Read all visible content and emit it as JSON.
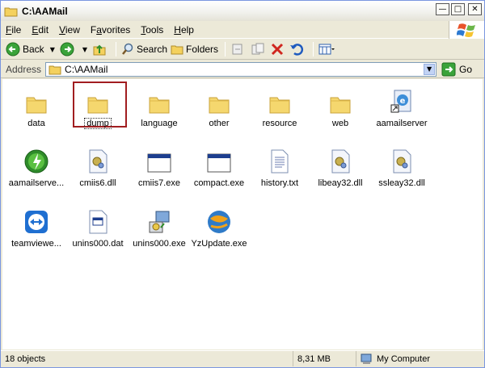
{
  "window": {
    "title": "C:\\AAMail"
  },
  "menu": [
    "File",
    "Edit",
    "View",
    "Favorites",
    "Tools",
    "Help"
  ],
  "menu_underline": [
    "F",
    "E",
    "V",
    "a",
    "T",
    "H"
  ],
  "toolbar": {
    "back_label": "Back",
    "search_label": "Search",
    "folders_label": "Folders"
  },
  "address": {
    "label": "Address",
    "value": "C:\\AAMail",
    "go_label": "Go"
  },
  "files": [
    {
      "name": "data",
      "icon": "folder-icon"
    },
    {
      "name": "dump",
      "icon": "folder-icon"
    },
    {
      "name": "language",
      "icon": "folder-icon"
    },
    {
      "name": "other",
      "icon": "folder-icon"
    },
    {
      "name": "resource",
      "icon": "folder-icon"
    },
    {
      "name": "web",
      "icon": "folder-icon"
    },
    {
      "name": "aamailserver",
      "icon": "shortcut-icon"
    },
    {
      "name": "aamailserve...",
      "icon": "app-green-icon"
    },
    {
      "name": "cmiis6.dll",
      "icon": "dll-icon"
    },
    {
      "name": "cmiis7.exe",
      "icon": "exe-icon"
    },
    {
      "name": "compact.exe",
      "icon": "exe-icon"
    },
    {
      "name": "history.txt",
      "icon": "text-file-icon"
    },
    {
      "name": "libeay32.dll",
      "icon": "dll-icon"
    },
    {
      "name": "ssleay32.dll",
      "icon": "dll-icon"
    },
    {
      "name": "teamviewe...",
      "icon": "teamviewer-icon"
    },
    {
      "name": "unins000.dat",
      "icon": "dat-icon"
    },
    {
      "name": "unins000.exe",
      "icon": "installer-icon"
    },
    {
      "name": "YzUpdate.exe",
      "icon": "globe-icon"
    }
  ],
  "status": {
    "objects": "18 objects",
    "size": "8,31 MB",
    "location": "My Computer"
  },
  "colors": {
    "selection_border": "#a11d20",
    "folder": "#f5d76e",
    "titlebar": "#f2f2ee"
  }
}
